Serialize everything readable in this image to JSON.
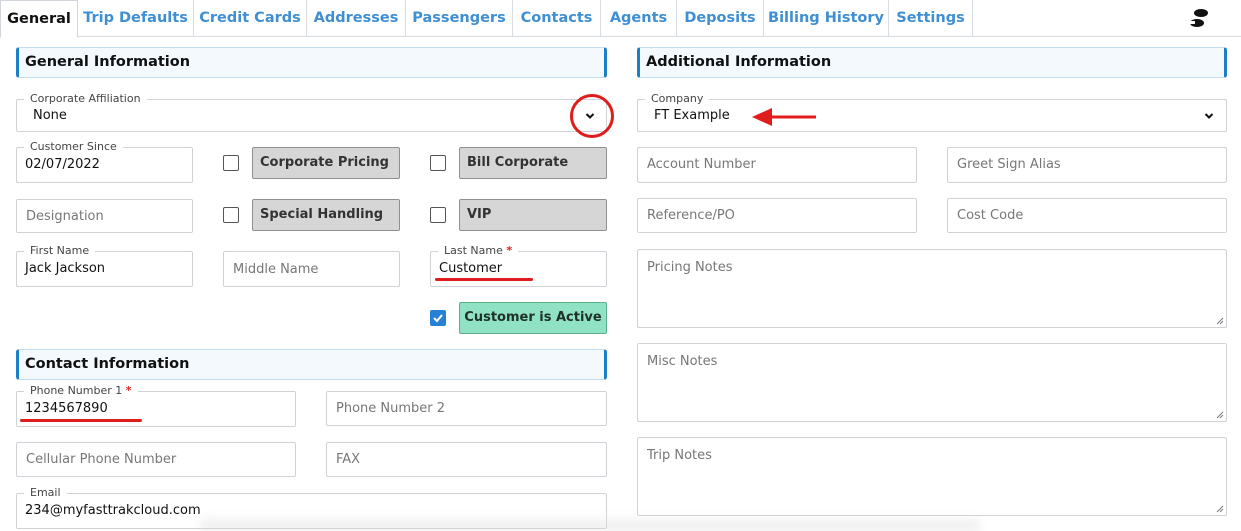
{
  "tabs": [
    {
      "label": "General",
      "active": true
    },
    {
      "label": "Trip Defaults"
    },
    {
      "label": "Credit Cards"
    },
    {
      "label": "Addresses"
    },
    {
      "label": "Passengers"
    },
    {
      "label": "Contacts"
    },
    {
      "label": "Agents"
    },
    {
      "label": "Deposits"
    },
    {
      "label": "Billing History"
    },
    {
      "label": "Settings"
    }
  ],
  "general_info": {
    "title": "General Information",
    "corporate_affiliation": {
      "label": "Corporate Affiliation",
      "value": "None"
    },
    "customer_since": {
      "label": "Customer Since",
      "value": "02/07/2022"
    },
    "corporate_pricing": {
      "label": "Corporate Pricing",
      "checked": false
    },
    "bill_corporate": {
      "label": "Bill Corporate",
      "checked": false
    },
    "designation": {
      "placeholder": "Designation"
    },
    "special_handling": {
      "label": "Special Handling",
      "checked": false
    },
    "vip": {
      "label": "VIP",
      "checked": false
    },
    "first_name": {
      "label": "First Name",
      "value": "Jack Jackson"
    },
    "middle_name": {
      "placeholder": "Middle Name"
    },
    "last_name": {
      "label": "Last Name",
      "required": "*",
      "value": "Customer"
    },
    "customer_active": {
      "label": "Customer is Active",
      "checked": true
    }
  },
  "contact_info": {
    "title": "Contact Information",
    "phone1": {
      "label": "Phone Number 1",
      "required": "*",
      "value": "1234567890"
    },
    "phone2": {
      "placeholder": "Phone Number 2"
    },
    "cellular": {
      "placeholder": "Cellular Phone Number"
    },
    "fax": {
      "placeholder": "FAX"
    },
    "email": {
      "label": "Email",
      "value": "234@myfasttrakcloud.com"
    }
  },
  "additional_info": {
    "title": "Additional Information",
    "company": {
      "label": "Company",
      "value": "FT Example"
    },
    "account_number": {
      "placeholder": "Account Number"
    },
    "greet_sign_alias": {
      "placeholder": "Greet Sign Alias"
    },
    "reference_po": {
      "placeholder": "Reference/PO"
    },
    "cost_code": {
      "placeholder": "Cost Code"
    },
    "pricing_notes": {
      "placeholder": "Pricing Notes"
    },
    "misc_notes": {
      "placeholder": "Misc Notes"
    },
    "trip_notes": {
      "placeholder": "Trip Notes"
    }
  },
  "colors": {
    "tab_text": "#3f8fd2",
    "section_accent": "#1f7fc6",
    "annotation_red": "#e01d1d",
    "active_green": "#8fe3c4",
    "checkbox_blue": "#2680d3"
  },
  "icons": {
    "tab_icon": "footprints-icon",
    "dropdown": "chevron-down-icon"
  }
}
